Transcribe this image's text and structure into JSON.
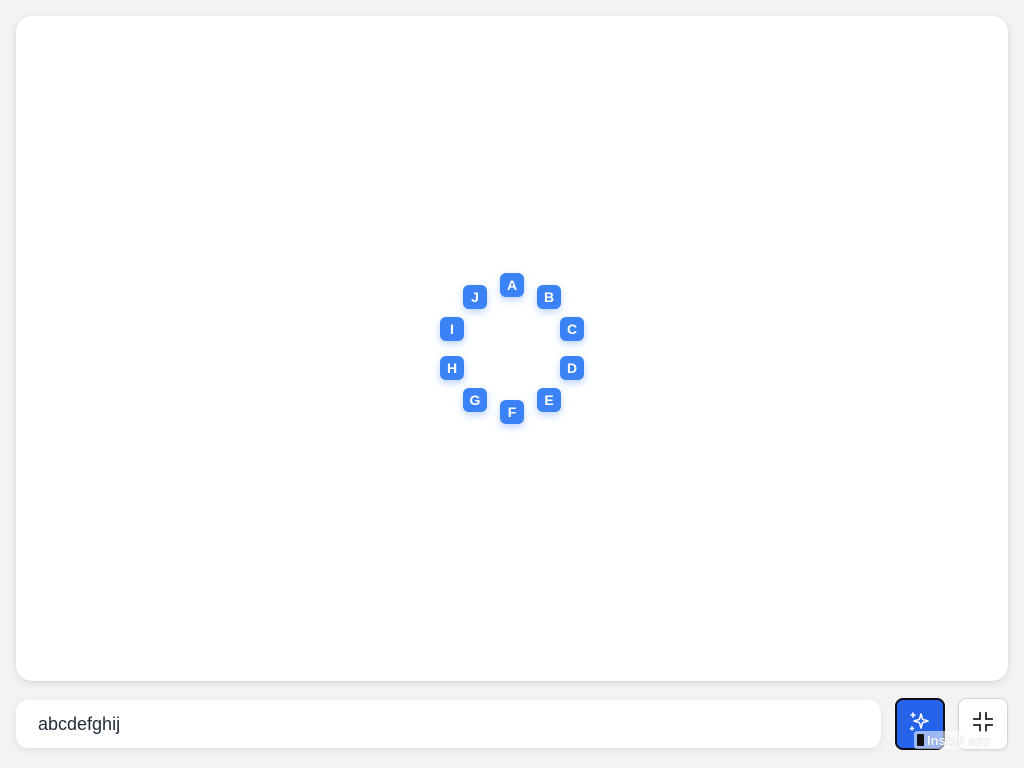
{
  "canvas": {
    "nodes": [
      {
        "label": "A"
      },
      {
        "label": "B"
      },
      {
        "label": "C"
      },
      {
        "label": "D"
      },
      {
        "label": "E"
      },
      {
        "label": "F"
      },
      {
        "label": "G"
      },
      {
        "label": "H"
      },
      {
        "label": "I"
      },
      {
        "label": "J"
      }
    ]
  },
  "input": {
    "value": "abcdefghij"
  },
  "buttons": {
    "generate": {
      "icon": "sparkle-icon"
    },
    "collapse": {
      "icon": "collapse-icon"
    }
  },
  "install_prompt": {
    "label": "Install app"
  },
  "colors": {
    "node": "#3b82f6",
    "primary_button": "#2563eb",
    "page_bg": "#f3f3f4",
    "canvas_bg": "#ffffff"
  }
}
